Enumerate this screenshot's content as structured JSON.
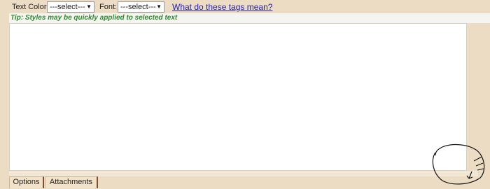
{
  "toolbar": {
    "text_color_label": "Text Color:",
    "text_color_value": "---select---",
    "font_label": "Font:",
    "font_value": "---select---",
    "help_link": "What do these tags mean?"
  },
  "tip": "Tip: Styles may be quickly applied to selected text",
  "editor": {
    "value": ""
  },
  "tabs": [
    {
      "label": "Options"
    },
    {
      "label": "Attachments"
    }
  ],
  "colors": {
    "background": "#ecdcc4",
    "tip_text": "#2f8a2f",
    "link": "#2222aa",
    "tab_edge": "#7a5030"
  },
  "annotation": {
    "type": "hand-drawn-circle-with-cursor"
  }
}
